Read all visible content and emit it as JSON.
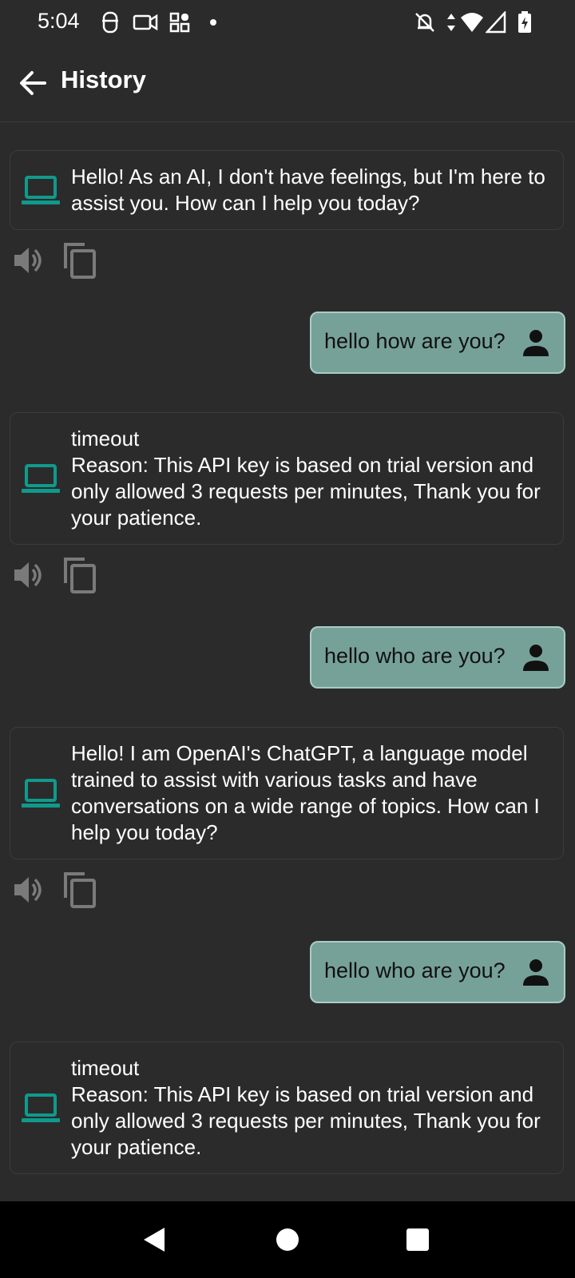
{
  "status_bar": {
    "time": "5:04",
    "left_icons": [
      "notification-app-icon",
      "video-camera-icon",
      "widget-grid-icon",
      "dot-icon"
    ],
    "right_icons": [
      "bell-off-icon",
      "data-arrows-icon",
      "wifi-icon",
      "cell-signal-icon",
      "battery-charging-icon"
    ]
  },
  "app_bar": {
    "title": "History"
  },
  "messages": [
    {
      "sender": "bot",
      "text": "Hello! As an AI, I don't have feelings, but I'm here to assist you. How can I help you today?"
    },
    {
      "sender": "user",
      "text": "hello how are you?"
    },
    {
      "sender": "bot",
      "text": "timeout\nReason: This API key is based on trial version and only allowed 3 requests per minutes, Thank you for your patience."
    },
    {
      "sender": "user",
      "text": "hello who are you?"
    },
    {
      "sender": "bot",
      "text": "Hello! I am OpenAI's ChatGPT, a language model trained to assist with various tasks and have conversations on a wide range of topics. How can I help you today?"
    },
    {
      "sender": "user",
      "text": "hello who are you?"
    },
    {
      "sender": "bot",
      "text": "timeout\nReason: This API key is based on trial version and only allowed 3 requests per minutes, Thank you for your patience."
    }
  ],
  "colors": {
    "background": "#2b2b2b",
    "bot_icon": "#0f9a8c",
    "user_bubble": "#76a199",
    "user_bubble_border": "#a9ccc6",
    "action_icon": "#7a7a7a"
  },
  "nav_bar": {
    "buttons": [
      "back-triangle-icon",
      "home-circle-icon",
      "recents-square-icon"
    ]
  }
}
